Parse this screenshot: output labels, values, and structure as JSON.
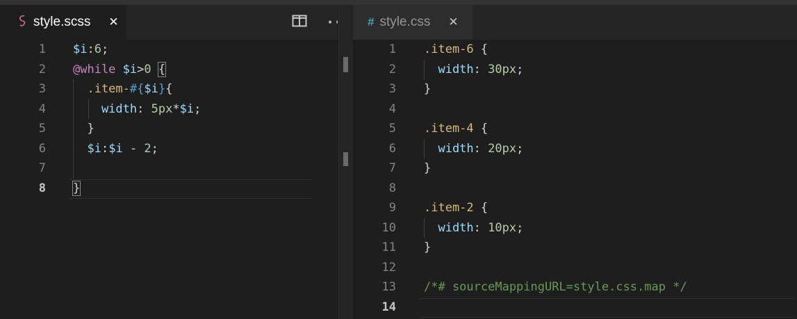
{
  "left_tab": {
    "icon": "sass-icon",
    "title": "style.scss",
    "close": "✕"
  },
  "right_tab": {
    "icon": "css-hash-icon",
    "icon_glyph": "#",
    "title": "style.css",
    "close": "✕"
  },
  "actions": {
    "split_icon": "split-editor-icon",
    "more": "···"
  },
  "left_lines": [
    {
      "n": "1",
      "parts": [
        [
          "var",
          "$i"
        ],
        [
          "op",
          ":"
        ],
        [
          "num",
          "6"
        ],
        [
          "op",
          ";"
        ]
      ]
    },
    {
      "n": "2",
      "parts": [
        [
          "kw",
          "@while"
        ],
        [
          "op",
          " "
        ],
        [
          "var",
          "$i"
        ],
        [
          "op",
          ">"
        ],
        [
          "num",
          "0"
        ],
        [
          "op",
          " "
        ],
        [
          "brace",
          "{"
        ]
      ]
    },
    {
      "n": "3",
      "parts": [
        [
          "sel",
          "  .item-"
        ],
        [
          "interp",
          "#{"
        ],
        [
          "var",
          "$i"
        ],
        [
          "interp",
          "}"
        ],
        [
          "brace",
          "{"
        ]
      ]
    },
    {
      "n": "4",
      "parts": [
        [
          "prop",
          "    width"
        ],
        [
          "op",
          ": "
        ],
        [
          "num",
          "5px"
        ],
        [
          "op",
          "*"
        ],
        [
          "var",
          "$i"
        ],
        [
          "op",
          ";"
        ]
      ]
    },
    {
      "n": "5",
      "parts": [
        [
          "brace",
          "  }"
        ]
      ]
    },
    {
      "n": "6",
      "parts": [
        [
          "var",
          "  $i"
        ],
        [
          "op",
          ":"
        ],
        [
          "var",
          "$i"
        ],
        [
          "op",
          " - "
        ],
        [
          "num",
          "2"
        ],
        [
          "op",
          ";"
        ]
      ]
    },
    {
      "n": "7",
      "parts": []
    },
    {
      "n": "8",
      "parts": [
        [
          "brace",
          "}"
        ]
      ]
    }
  ],
  "right_lines": [
    {
      "n": "1",
      "parts": [
        [
          "sel",
          ".item-6"
        ],
        [
          "op",
          " {"
        ]
      ]
    },
    {
      "n": "2",
      "parts": [
        [
          "prop",
          "  width"
        ],
        [
          "op",
          ": "
        ],
        [
          "num",
          "30px"
        ],
        [
          "op",
          ";"
        ]
      ]
    },
    {
      "n": "3",
      "parts": [
        [
          "op",
          "}"
        ]
      ]
    },
    {
      "n": "4",
      "parts": []
    },
    {
      "n": "5",
      "parts": [
        [
          "sel",
          ".item-4"
        ],
        [
          "op",
          " {"
        ]
      ]
    },
    {
      "n": "6",
      "parts": [
        [
          "prop",
          "  width"
        ],
        [
          "op",
          ": "
        ],
        [
          "num",
          "20px"
        ],
        [
          "op",
          ";"
        ]
      ]
    },
    {
      "n": "7",
      "parts": [
        [
          "op",
          "}"
        ]
      ]
    },
    {
      "n": "8",
      "parts": []
    },
    {
      "n": "9",
      "parts": [
        [
          "sel",
          ".item-2"
        ],
        [
          "op",
          " {"
        ]
      ]
    },
    {
      "n": "10",
      "parts": [
        [
          "prop",
          "  width"
        ],
        [
          "op",
          ": "
        ],
        [
          "num",
          "10px"
        ],
        [
          "op",
          ";"
        ]
      ]
    },
    {
      "n": "11",
      "parts": [
        [
          "op",
          "}"
        ]
      ]
    },
    {
      "n": "12",
      "parts": []
    },
    {
      "n": "13",
      "parts": [
        [
          "comment",
          "/*# sourceMappingURL=style.css.map */"
        ]
      ]
    },
    {
      "n": "14",
      "parts": []
    }
  ],
  "colors": {
    "background": "#1e1e1e",
    "tabbar": "#252526",
    "accent_scss": "#cd6799",
    "accent_css": "#519aba"
  }
}
